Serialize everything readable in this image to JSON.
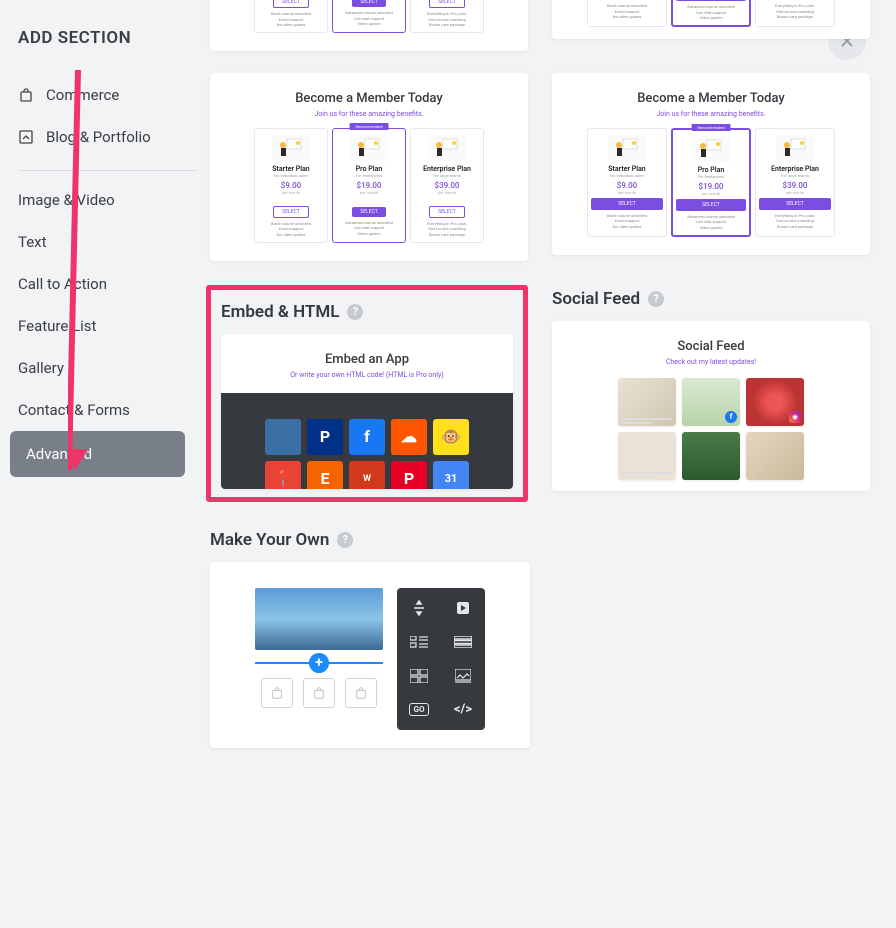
{
  "sidebar": {
    "title": "ADD SECTION",
    "groups": {
      "commerce": "Commerce",
      "blog": "Blog & Portfolio"
    },
    "categories": [
      "Image & Video",
      "Text",
      "Call to Action",
      "Feature List",
      "Gallery",
      "Contact & Forms",
      "Advanced"
    ],
    "active": "Advanced"
  },
  "pricing": {
    "heading": "Become a Member Today",
    "sub": "Join us for these amazing benefits.",
    "recommended": "Recommended",
    "plans": [
      {
        "name": "Starter Plan",
        "for": "For individual users",
        "price": "$9.00",
        "per": "per month",
        "btn": "SELECT",
        "feat": "Basic course unlocked\nEmail support\nNo video guides"
      },
      {
        "name": "Pro Plan",
        "for": "For freelancers",
        "price": "$19.00",
        "per": "per month",
        "btn": "SELECT",
        "feat": "Advanced course unlocked\nLive chat support\nVideo guides"
      },
      {
        "name": "Enterprise Plan",
        "for": "For large teams",
        "price": "$39.00",
        "per": "per month",
        "btn": "SELECT",
        "feat": "Everything in Pro, plus:\nOne-on-one coaching\nBonus care package"
      }
    ]
  },
  "embed": {
    "label": "Embed & HTML",
    "heading": "Embed an App",
    "sub": "Or write your own HTML code! (HTML is Pro only)",
    "apps": [
      "code",
      "paypal",
      "facebook",
      "soundcloud",
      "mailchimp",
      "maps",
      "etsy",
      "wufoo",
      "pinterest",
      "calendar"
    ]
  },
  "social": {
    "label": "Social Feed",
    "heading": "Social Feed",
    "sub": "Check out my latest updates!"
  },
  "myo": {
    "label": "Make Your Own"
  },
  "colors": {
    "accent": "#7b4de0",
    "highlight": "#f0336a"
  }
}
